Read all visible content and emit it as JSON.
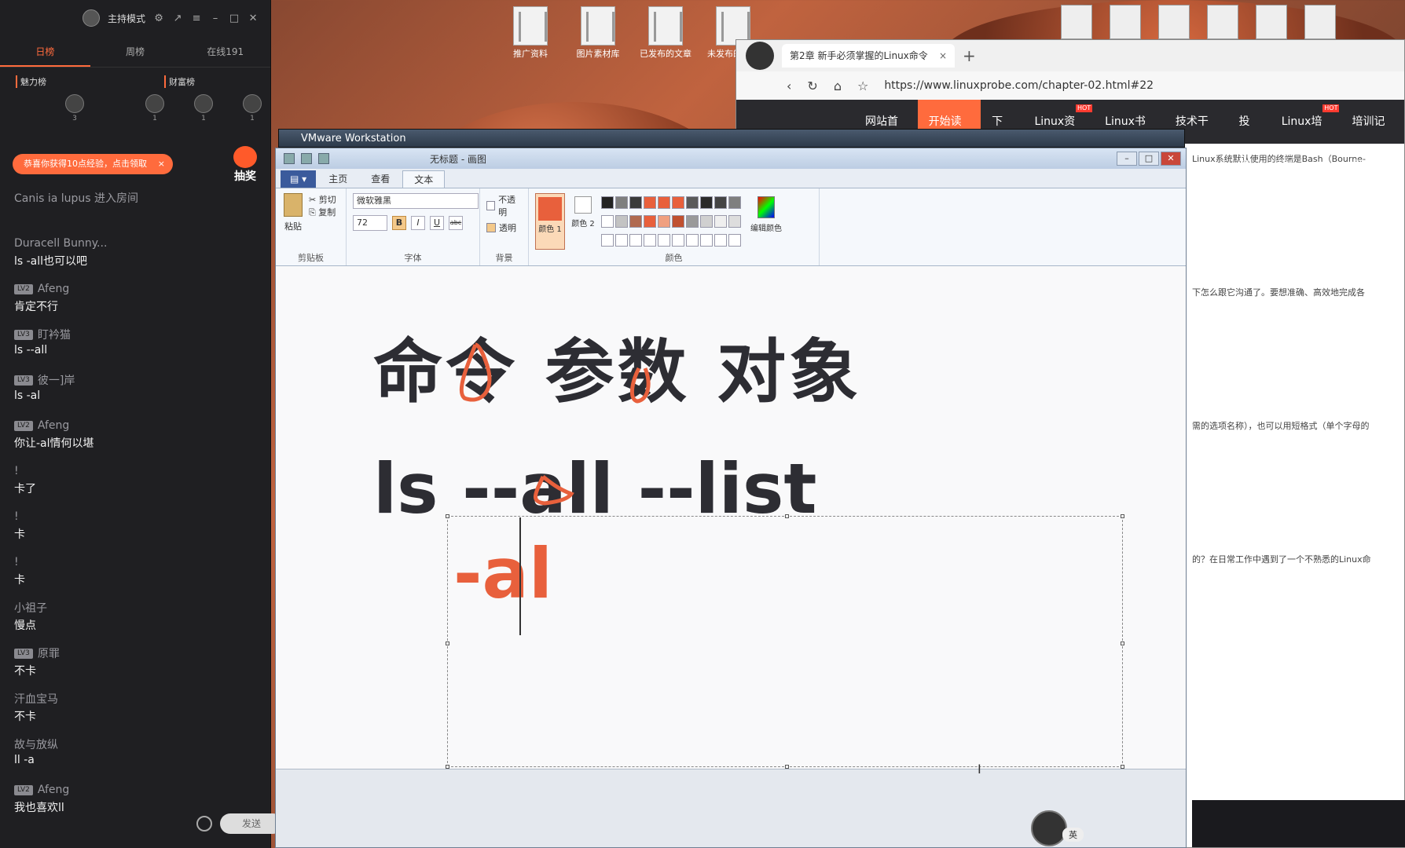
{
  "desktop": {
    "icons": [
      "推广资料",
      "图片素材库",
      "已发布的文章",
      "未发布的文章"
    ]
  },
  "chat": {
    "host_mode": "主持模式",
    "tabs": [
      "日榜",
      "周榜",
      "在线191"
    ],
    "ranks": [
      "魅力榜",
      "财富榜"
    ],
    "rank_counts": [
      "3",
      "1",
      "1",
      "1"
    ],
    "banner": "恭喜你获得10点经验，点击领取",
    "banner_close": "×",
    "lottery": "抽奖",
    "messages": [
      {
        "name": "Canis ia lupus 进入房间",
        "level": "",
        "text": ""
      },
      {
        "name": "Duracell Bunny...",
        "level": "",
        "text": "ls -all也可以吧"
      },
      {
        "name": "Afeng",
        "level": "LV2",
        "text": "肯定不行"
      },
      {
        "name": "盯衿猫",
        "level": "LV3",
        "text": "ls --all"
      },
      {
        "name": "彼一]岸",
        "level": "LV3",
        "text": "ls -al"
      },
      {
        "name": "Afeng",
        "level": "LV2",
        "text": "你让-al情何以堪"
      },
      {
        "name": "!",
        "level": "",
        "text": "卡了"
      },
      {
        "name": "!",
        "level": "",
        "text": "卡"
      },
      {
        "name": "!",
        "level": "",
        "text": "卡"
      },
      {
        "name": "小祖子",
        "level": "",
        "text": "慢点"
      },
      {
        "name": "原罪",
        "level": "LV3",
        "text": "不卡"
      },
      {
        "name": "汗血宝马",
        "level": "",
        "text": "不卡"
      },
      {
        "name": "故与放纵",
        "level": "",
        "text": "ll -a"
      },
      {
        "name": "Afeng",
        "level": "LV2",
        "text": "我也喜欢ll"
      }
    ],
    "send_label": "发送"
  },
  "browser": {
    "tab_title": "第2章 新手必须掌握的Linux命令",
    "tab_close": "×",
    "new_tab": "+",
    "url": "https://www.linuxprobe.com/chapter-02.html#22",
    "nav": [
      "网站首页",
      "开始读书",
      "下载",
      "Linux资讯",
      "Linux书籍",
      "技术干货",
      "投稿",
      "Linux培训",
      "培训记录"
    ],
    "nav_active": "开始读书",
    "hot_label": "HOT",
    "body_snippets": [
      "Linux系统默认使用的终端是Bash（Bourne-",
      "下怎么跟它沟通了。要想准确、高效地完成各",
      "需的选项名称），也可以用短格式（单个字母的",
      "的？在日常工作中遇到了一个不熟悉的Linux命"
    ]
  },
  "vmware": {
    "title": "VMware Workstation"
  },
  "paint": {
    "title": "无标题 - 画图",
    "tabs": [
      "主页",
      "查看",
      "文本"
    ],
    "active_tab": "文本",
    "clipboard": {
      "paste": "粘贴",
      "cut": "剪切",
      "copy": "复制",
      "label": "剪贴板"
    },
    "font": {
      "name": "微软雅黑",
      "size": "72",
      "label": "字体",
      "bold": "B",
      "italic": "I",
      "underline": "U",
      "strike": "abc"
    },
    "background": {
      "opaque": "不透明",
      "transparent": "透明",
      "label": "背景"
    },
    "colors": {
      "color1": "颜色 1",
      "color2": "颜色 2",
      "edit": "编辑颜色",
      "label": "颜色"
    },
    "palette": [
      "#222222",
      "#7f7f7f",
      "#3a3a3a",
      "#e8603c",
      "#e8603c",
      "#e8603c",
      "#5a5a5a",
      "#2a2a2a",
      "#444444",
      "#7f7f7f",
      "#ffffff",
      "#c3c3c3",
      "#b06a50",
      "#e8603c",
      "#f0a080",
      "#c05030",
      "#9a9a9a",
      "#d0d0d0",
      "#efefef",
      "#dddddd",
      "#ffffff",
      "#ffffff",
      "#ffffff",
      "#ffffff",
      "#ffffff",
      "#ffffff",
      "#ffffff",
      "#ffffff",
      "#ffffff",
      "#ffffff"
    ],
    "canvas": {
      "line1": "命令 参数 对象",
      "line2": "ls --all --list",
      "editing": "-al"
    }
  },
  "presenter": {
    "ime": "英"
  },
  "colors": {
    "accent": "#ff6b3d",
    "paint_text": "#e8603c",
    "dark_text": "#2d2d33"
  }
}
